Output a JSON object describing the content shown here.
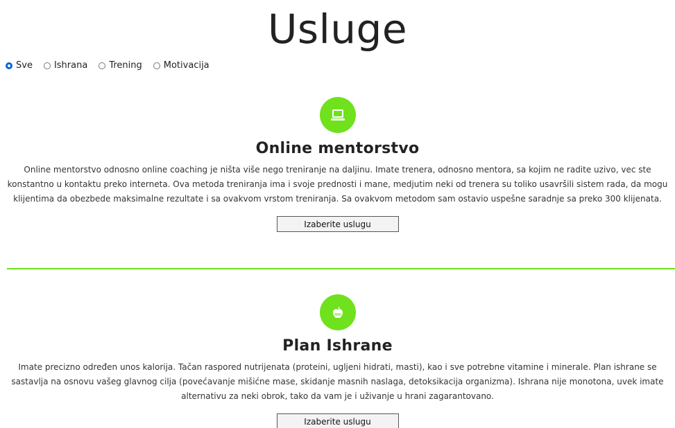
{
  "page": {
    "title": "Usluge"
  },
  "filters": [
    {
      "label": "Sve",
      "checked": true
    },
    {
      "label": "Ishrana",
      "checked": false
    },
    {
      "label": "Trening",
      "checked": false
    },
    {
      "label": "Motivacija",
      "checked": false
    }
  ],
  "services": [
    {
      "icon": "laptop-icon",
      "title": "Online mentorstvo",
      "description": "Online mentorstvo odnosno online coaching je ništa više nego treniranje na daljinu. Imate trenera, odnosno mentora, sa kojim ne radite uzivo, vec ste konstantno u kontaktu preko interneta. Ova metoda treniranja ima i svoje prednosti i mane, medjutim neki od trenera su toliko usavršili sistem rada, da mogu klijentima da obezbede maksimalne rezultate i sa ovakvom vrstom treniranja. Sa ovakvom metodom sam ostavio uspešne saradnje sa preko 300 klijenata.",
      "button": "Izaberite uslugu"
    },
    {
      "icon": "apple-icon",
      "title": "Plan Ishrane",
      "description": "Imate precizno određen unos kalorija. Tačan raspored nutrijenata (proteini, ugljeni hidrati, masti), kao i sve potrebne vitamine i minerale. Plan ishrane se sastavlja na osnovu vašeg glavnog cilja (povećavanje mišićne mase, skidanje masnih naslaga, detoksikacija organizma). Ishrana nije monotona, uvek imate alternativu za neki obrok, tako da vam je i uživanje u hrani zagarantovano.",
      "button": "Izaberite uslugu"
    }
  ],
  "colors": {
    "accent": "#6fe11d",
    "radio_checked": "#0a64d6"
  }
}
